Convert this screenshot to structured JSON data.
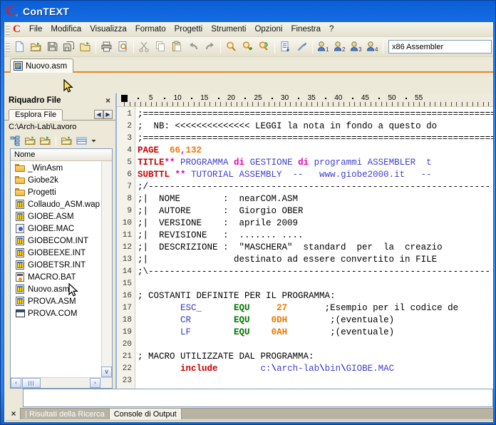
{
  "window": {
    "title": "ConTEXT",
    "logo_icon": "context-c-logo-icon"
  },
  "menu": {
    "items": [
      {
        "label": "File",
        "name": "menu-file"
      },
      {
        "label": "Modifica",
        "name": "menu-modifica"
      },
      {
        "label": "Visualizza",
        "name": "menu-visualizza"
      },
      {
        "label": "Formato",
        "name": "menu-formato"
      },
      {
        "label": "Progetti",
        "name": "menu-progetti"
      },
      {
        "label": "Strumenti",
        "name": "menu-strumenti"
      },
      {
        "label": "Opzioni",
        "name": "menu-opzioni"
      },
      {
        "label": "Finestra",
        "name": "menu-finestra"
      },
      {
        "label": "?",
        "name": "menu-help"
      }
    ]
  },
  "toolbar": {
    "buttons": [
      {
        "icon": "new-file-icon",
        "name": "toolbar-new"
      },
      {
        "icon": "open-folder-icon",
        "name": "toolbar-open"
      },
      {
        "icon": "save-icon",
        "name": "toolbar-save"
      },
      {
        "icon": "save-all-icon",
        "name": "toolbar-save-all"
      },
      {
        "icon": "open-project-icon",
        "name": "toolbar-open-project"
      },
      {
        "icon": "print-icon",
        "name": "toolbar-print"
      },
      {
        "icon": "print-preview-icon",
        "name": "toolbar-print-preview"
      },
      {
        "icon": "cut-scissors-icon",
        "name": "toolbar-cut"
      },
      {
        "icon": "copy-icon",
        "name": "toolbar-copy"
      },
      {
        "icon": "paste-icon",
        "name": "toolbar-paste"
      },
      {
        "icon": "undo-arrow-icon",
        "name": "toolbar-undo"
      },
      {
        "icon": "redo-arrow-icon",
        "name": "toolbar-redo"
      },
      {
        "icon": "search-magnifier-icon",
        "name": "toolbar-find"
      },
      {
        "icon": "find-next-magnifier-icon",
        "name": "toolbar-find-next"
      },
      {
        "icon": "replace-magnifier-icon",
        "name": "toolbar-replace"
      },
      {
        "icon": "sort-lines-icon",
        "name": "toolbar-sort"
      },
      {
        "icon": "wand-icon",
        "name": "toolbar-wand"
      },
      {
        "icon": "user-1-icon",
        "name": "toolbar-exec-1"
      },
      {
        "icon": "user-2-icon",
        "name": "toolbar-exec-2"
      },
      {
        "icon": "user-3-icon",
        "name": "toolbar-exec-3"
      },
      {
        "icon": "user-4-icon",
        "name": "toolbar-exec-4"
      }
    ],
    "language": "x86 Assembler"
  },
  "doc_tabs": [
    {
      "label": "Nuovo.asm",
      "icon": "asm-file-icon",
      "active": true
    }
  ],
  "file_panel": {
    "header": "Riquadro File",
    "close_label": "×",
    "tab": "Esplora File",
    "nav_prev": "◀",
    "nav_next": "▶",
    "path": "C:\\Arch-Lab\\Lavoro",
    "toolbar": [
      {
        "icon": "folder-tree-icon",
        "name": "fp-tree-button"
      },
      {
        "icon": "folder-up-icon",
        "name": "fp-up-button"
      },
      {
        "icon": "folder-refresh-icon",
        "name": "fp-refresh-button"
      },
      {
        "icon": "folder-open-icon",
        "name": "fp-open-button"
      },
      {
        "icon": "view-list-icon",
        "name": "fp-view-button"
      },
      {
        "icon": "chevron-down-icon",
        "name": "fp-view-dropdown"
      }
    ],
    "column_header": "Nome",
    "files": [
      {
        "name": "_WinAsm",
        "type": "folder"
      },
      {
        "name": "Giobe2k",
        "type": "folder"
      },
      {
        "name": "Progetti",
        "type": "folder"
      },
      {
        "name": "Collaudo_ASM.wap",
        "type": "asm"
      },
      {
        "name": "GIOBE.ASM",
        "type": "asm"
      },
      {
        "name": "GIOBE.MAC",
        "type": "mac"
      },
      {
        "name": "GIOBECOM.INT",
        "type": "asm"
      },
      {
        "name": "GIOBEEXE.INT",
        "type": "asm"
      },
      {
        "name": "GIOBETSR.INT",
        "type": "asm"
      },
      {
        "name": "MACRO.BAT",
        "type": "bat"
      },
      {
        "name": "Nuovo.asm",
        "type": "asm"
      },
      {
        "name": "PROVA.ASM",
        "type": "asm"
      },
      {
        "name": "PROVA.COM",
        "type": "com"
      }
    ],
    "hscroll_left": "‹",
    "hscroll_right": "›",
    "vscroll_down": "∨"
  },
  "ruler": {
    "marks": [
      5,
      10,
      15,
      20,
      25,
      30,
      35,
      40,
      45,
      50,
      55
    ]
  },
  "editor": {
    "first_line": 1,
    "lines": [
      {
        "n": 1,
        "tokens": [
          {
            "t": ";==================================================================",
            "c": "cmt"
          }
        ]
      },
      {
        "n": 2,
        "tokens": [
          {
            "t": ";  NB: <<<<<<<<<<<<<< LEGGI la nota in fondo a questo do",
            "c": "cmt"
          }
        ]
      },
      {
        "n": 3,
        "tokens": [
          {
            "t": ";==================================================================",
            "c": "cmt"
          }
        ]
      },
      {
        "n": 4,
        "tokens": [
          {
            "t": "PAGE ",
            "c": "kw"
          },
          {
            "t": " 66",
            "c": "num"
          },
          {
            "t": ",",
            "c": "op"
          },
          {
            "t": "132",
            "c": "num"
          }
        ]
      },
      {
        "n": 5,
        "tokens": [
          {
            "t": "TITLE",
            "c": "kw"
          },
          {
            "t": "**",
            "c": "op"
          },
          {
            "t": " PROGRAMMA ",
            "c": "str"
          },
          {
            "t": "di",
            "c": "op"
          },
          {
            "t": " GESTIONE ",
            "c": "str"
          },
          {
            "t": "di",
            "c": "op"
          },
          {
            "t": " programmi ASSEMBLER  t",
            "c": "str"
          }
        ]
      },
      {
        "n": 6,
        "tokens": [
          {
            "t": "SUBTTL",
            "c": "kw"
          },
          {
            "t": " **",
            "c": "op"
          },
          {
            "t": " TUTORIAL ASSEMBLY  --   www.giobe2000.it   --",
            "c": "str"
          }
        ]
      },
      {
        "n": 7,
        "tokens": [
          {
            "t": ";/----------------------------------------------------------------",
            "c": "cmt"
          }
        ]
      },
      {
        "n": 8,
        "tokens": [
          {
            "t": ";|  NOME        :  nearCOM.ASM",
            "c": "cmt"
          }
        ]
      },
      {
        "n": 9,
        "tokens": [
          {
            "t": ";|  AUTORE      :  Giorgio OBER",
            "c": "cmt"
          }
        ]
      },
      {
        "n": 10,
        "tokens": [
          {
            "t": ";|  VERSIONE    :  aprile 2009",
            "c": "cmt"
          }
        ]
      },
      {
        "n": 11,
        "tokens": [
          {
            "t": ";|  REVISIONE   :  ....... ....",
            "c": "cmt"
          }
        ]
      },
      {
        "n": 12,
        "tokens": [
          {
            "t": ";|  DESCRIZIONE :  \"MASCHERA\"  standard  per  la  creazio",
            "c": "cmt"
          }
        ]
      },
      {
        "n": 13,
        "tokens": [
          {
            "t": ";|                destinato ad essere convertito in FILE",
            "c": "cmt"
          }
        ]
      },
      {
        "n": 14,
        "tokens": [
          {
            "t": ";\\----------------------------------------------------------------",
            "c": "cmt"
          }
        ]
      },
      {
        "n": 15,
        "tokens": [
          {
            "t": "",
            "c": "cmt"
          }
        ]
      },
      {
        "n": 16,
        "tokens": [
          {
            "t": "; COSTANTI DEFINITE PER IL PROGRAMMA:",
            "c": "cmt"
          }
        ]
      },
      {
        "n": 17,
        "tokens": [
          {
            "t": "        ",
            "c": "cmt"
          },
          {
            "t": "ESC_",
            "c": "id"
          },
          {
            "t": "      ",
            "c": "cmt"
          },
          {
            "t": "EQU",
            "c": "equ"
          },
          {
            "t": "     ",
            "c": "cmt"
          },
          {
            "t": "27",
            "c": "num"
          },
          {
            "t": "       ;Esempio per il codice de",
            "c": "cmt"
          }
        ]
      },
      {
        "n": 18,
        "tokens": [
          {
            "t": "        ",
            "c": "cmt"
          },
          {
            "t": "CR",
            "c": "id"
          },
          {
            "t": "        ",
            "c": "cmt"
          },
          {
            "t": "EQU",
            "c": "equ"
          },
          {
            "t": "    ",
            "c": "cmt"
          },
          {
            "t": "0DH",
            "c": "num"
          },
          {
            "t": "        ;(eventuale)",
            "c": "cmt"
          }
        ]
      },
      {
        "n": 19,
        "tokens": [
          {
            "t": "        ",
            "c": "cmt"
          },
          {
            "t": "LF",
            "c": "id"
          },
          {
            "t": "        ",
            "c": "cmt"
          },
          {
            "t": "EQU",
            "c": "equ"
          },
          {
            "t": "    ",
            "c": "cmt"
          },
          {
            "t": "0AH",
            "c": "num"
          },
          {
            "t": "        ;(eventuale)",
            "c": "cmt"
          }
        ]
      },
      {
        "n": 20,
        "tokens": [
          {
            "t": "",
            "c": "cmt"
          }
        ]
      },
      {
        "n": 21,
        "tokens": [
          {
            "t": "; MACRO UTILIZZATE DAL PROGRAMMA:",
            "c": "cmt"
          }
        ]
      },
      {
        "n": 22,
        "tokens": [
          {
            "t": "        ",
            "c": "cmt"
          },
          {
            "t": "include",
            "c": "kw"
          },
          {
            "t": "        ",
            "c": "cmt"
          },
          {
            "t": "c:",
            "c": "str"
          },
          {
            "t": "\\",
            "c": "sym"
          },
          {
            "t": "arch-lab",
            "c": "str"
          },
          {
            "t": "\\",
            "c": "sym"
          },
          {
            "t": "bin",
            "c": "str"
          },
          {
            "t": "\\",
            "c": "sym"
          },
          {
            "t": "GIOBE.MAC",
            "c": "str"
          }
        ]
      },
      {
        "n": 23,
        "tokens": [
          {
            "t": "",
            "c": "cmt"
          }
        ]
      }
    ]
  },
  "output_pane": {
    "close_label": "×",
    "tabs": [
      {
        "label": "| Risultati della Ricerca",
        "active": false,
        "name": "tab-search-results"
      },
      {
        "label": "Console di Output",
        "active": true,
        "name": "tab-output-console"
      }
    ]
  },
  "colors": {
    "title_blue": "#2b7de8",
    "chrome": "#ece9d8",
    "accent_orange": "#e08a20",
    "keyword_red": "#cc0000",
    "number_orange": "#ee7700",
    "string_blue": "#4040d0",
    "operator_magenta": "#ee00aa",
    "equ_green": "#007700"
  }
}
